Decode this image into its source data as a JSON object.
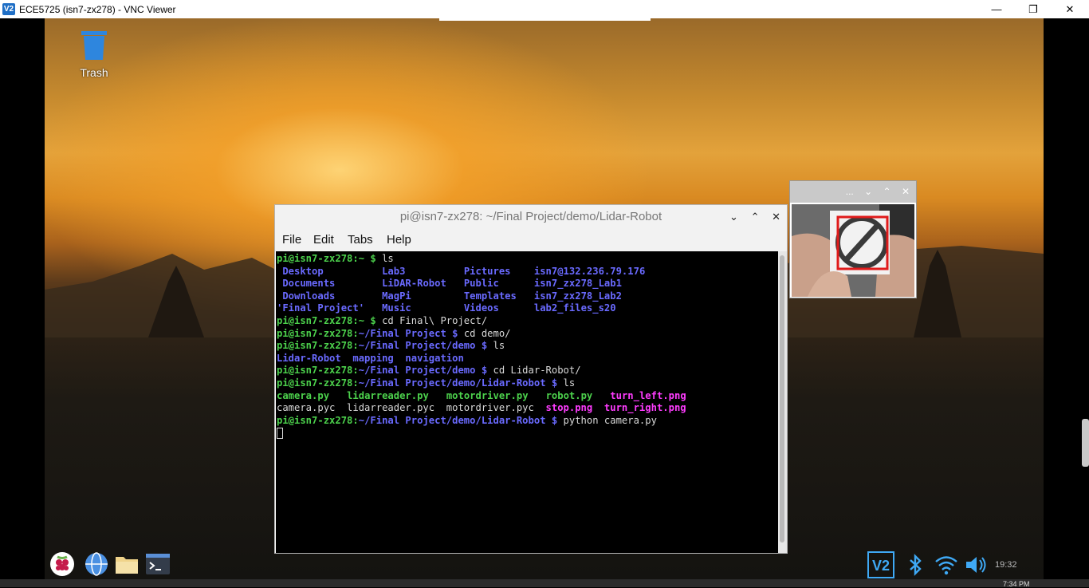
{
  "vnc": {
    "logo": "V2",
    "title": "ECE5725 (isn7-zx278) - VNC Viewer",
    "minimize": "—",
    "restore": "❐",
    "close": "✕"
  },
  "desktop": {
    "trash_label": "Trash"
  },
  "terminal": {
    "title": "pi@isn7-zx278: ~/Final Project/demo/Lidar-Robot",
    "btn_min": "⌄",
    "btn_max": "⌃",
    "btn_close": "✕",
    "menu": [
      "File",
      "Edit",
      "Tabs",
      "Help"
    ],
    "lines": [
      [
        {
          "t": "pi@isn7-zx278:~ $ ",
          "c": "g"
        },
        {
          "t": "ls",
          "c": "w"
        }
      ],
      [
        {
          "t": " Desktop          ",
          "c": "b"
        },
        {
          "t": "Lab3          ",
          "c": "b"
        },
        {
          "t": "Pictures    ",
          "c": "b"
        },
        {
          "t": "isn7@132.236.79.176",
          "c": "b"
        }
      ],
      [
        {
          "t": " Documents        ",
          "c": "b"
        },
        {
          "t": "LiDAR-Robot   ",
          "c": "b"
        },
        {
          "t": "Public      ",
          "c": "b"
        },
        {
          "t": "isn7_zx278_Lab1",
          "c": "b"
        }
      ],
      [
        {
          "t": " Downloads        ",
          "c": "b"
        },
        {
          "t": "MagPi         ",
          "c": "b"
        },
        {
          "t": "Templates   ",
          "c": "b"
        },
        {
          "t": "isn7_zx278_Lab2",
          "c": "b"
        }
      ],
      [
        {
          "t": "'Final Project'   ",
          "c": "b"
        },
        {
          "t": "Music         ",
          "c": "b"
        },
        {
          "t": "Videos      ",
          "c": "b"
        },
        {
          "t": "lab2_files_s20",
          "c": "b"
        }
      ],
      [
        {
          "t": "pi@isn7-zx278:~ $ ",
          "c": "g"
        },
        {
          "t": "cd Final\\ Project/",
          "c": "w"
        }
      ],
      [
        {
          "t": "pi@isn7-zx278:",
          "c": "g"
        },
        {
          "t": "~/Final Project $ ",
          "c": "b"
        },
        {
          "t": "cd demo/",
          "c": "w"
        }
      ],
      [
        {
          "t": "pi@isn7-zx278:",
          "c": "g"
        },
        {
          "t": "~/Final Project/demo $ ",
          "c": "b"
        },
        {
          "t": "ls",
          "c": "w"
        }
      ],
      [
        {
          "t": "Lidar-Robot  mapping  navigation",
          "c": "b"
        }
      ],
      [
        {
          "t": "pi@isn7-zx278:",
          "c": "g"
        },
        {
          "t": "~/Final Project/demo $ ",
          "c": "b"
        },
        {
          "t": "cd Lidar-Robot/",
          "c": "w"
        }
      ],
      [
        {
          "t": "pi@isn7-zx278:",
          "c": "g"
        },
        {
          "t": "~/Final Project/demo/Lidar-Robot $ ",
          "c": "b"
        },
        {
          "t": "ls",
          "c": "w"
        }
      ],
      [
        {
          "t": "camera.py   ",
          "c": "g"
        },
        {
          "t": "lidarreader.py   ",
          "c": "g"
        },
        {
          "t": "motordriver.py   ",
          "c": "g"
        },
        {
          "t": "robot.py   ",
          "c": "g"
        },
        {
          "t": "turn_left.png",
          "c": "m"
        }
      ],
      [
        {
          "t": "camera.pyc  lidarreader.pyc  motordriver.pyc  ",
          "c": "w"
        },
        {
          "t": "stop.png  ",
          "c": "m"
        },
        {
          "t": "turn_right.png",
          "c": "m"
        }
      ],
      [
        {
          "t": "pi@isn7-zx278:",
          "c": "g"
        },
        {
          "t": "~/Final Project/demo/Lidar-Robot $ ",
          "c": "b"
        },
        {
          "t": "python camera.py",
          "c": "w"
        }
      ]
    ]
  },
  "camera_window": {
    "btn_more": "...",
    "btn_min": "⌄",
    "btn_max": "⌃",
    "btn_close": "✕"
  },
  "tray": {
    "vnc": "V2",
    "time": "19:32"
  },
  "bottom_clock": "7:34 PM",
  "colors": {
    "prompt_green": "#4cd14c",
    "dir_blue": "#6a6aff",
    "image_magenta": "#ff3cff",
    "detect_box": "#e01b1b"
  }
}
